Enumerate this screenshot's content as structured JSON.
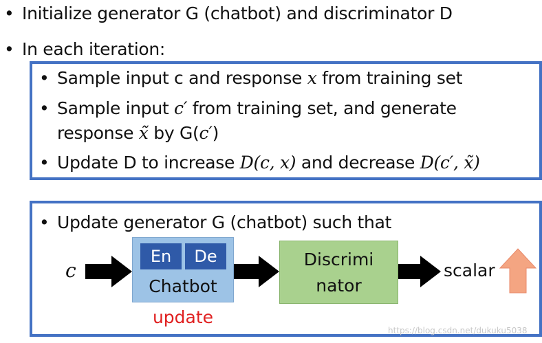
{
  "top_bullets": [
    "Initialize generator G (chatbot) and discriminator D",
    "In each iteration:"
  ],
  "bullet_glyph": "•",
  "inner_bullets": {
    "b1_pre": "Sample input c and response ",
    "b1_var": "x",
    "b1_post": " from training set",
    "b2_pre": "Sample input ",
    "b2_var": "c′",
    "b2_post": " from training set, and generate",
    "b2_line2_pre": "response ",
    "b2_line2_var": "x̃",
    "b2_line2_mid": " by G(",
    "b2_line2_var2": "c′",
    "b2_line2_post": ")",
    "b3_pre": "Update D to increase ",
    "b3_expr1": "D(c, x)",
    "b3_mid": " and decrease ",
    "b3_expr2": "D(c′, x̃)"
  },
  "lower_box": {
    "bullet": "Update generator G (chatbot) such that",
    "input_label": "c",
    "encoder_label": "En",
    "decoder_label": "De",
    "chatbot_label": "Chatbot",
    "discriminator_line1": "Discrimi",
    "discriminator_line2": "nator",
    "output_label": "scalar",
    "update_label": "update"
  },
  "watermark": "https://blog.csdn.net/dukuku5038",
  "colors": {
    "frame_blue": "#4472C4",
    "chatbot_fill": "#9DC3E6",
    "encdec_fill": "#2F5AA8",
    "discriminator_fill": "#A9D18E",
    "update_red": "#E02020",
    "up_arrow_fill": "#F4A582"
  }
}
